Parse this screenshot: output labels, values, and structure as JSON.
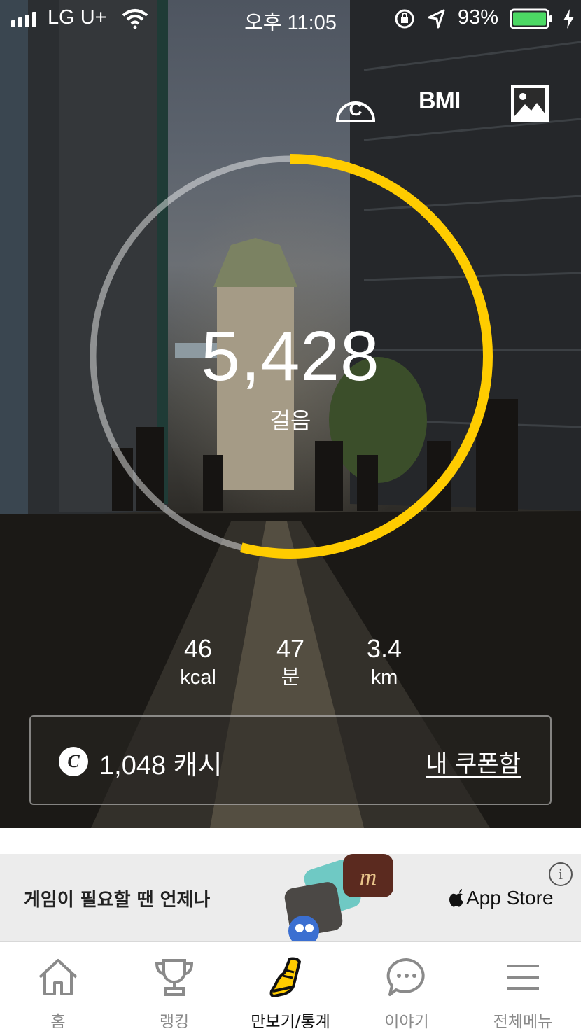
{
  "status_bar": {
    "carrier": "LG U+",
    "time": "오후 11:05",
    "battery": "93%",
    "battery_color": "#4cd964"
  },
  "top_actions": {
    "cash_icon": "cash-coin-icon",
    "bmi_label": "BMI",
    "photo_icon": "image-icon"
  },
  "pedometer": {
    "steps": "5,428",
    "steps_unit": "걸음",
    "progress": 0.54,
    "ring_color": "#ffcc00"
  },
  "stats": [
    {
      "value": "46",
      "unit": "kcal"
    },
    {
      "value": "47",
      "unit": "분"
    },
    {
      "value": "3.4",
      "unit": "km"
    }
  ],
  "cash": {
    "icon_letter": "C",
    "amount": "1,048 캐시",
    "coupon_link": "내 쿠폰함"
  },
  "ad": {
    "text": "게임이 필요할 땐 언제나",
    "store_label": "App Store",
    "info_label": "i"
  },
  "tabs": [
    {
      "label": "홈",
      "icon": "home-icon"
    },
    {
      "label": "랭킹",
      "icon": "trophy-icon"
    },
    {
      "label": "만보기/통계",
      "icon": "shoe-icon",
      "active": true
    },
    {
      "label": "이야기",
      "icon": "chat-bubble-icon"
    },
    {
      "label": "전체메뉴",
      "icon": "menu-icon"
    }
  ]
}
